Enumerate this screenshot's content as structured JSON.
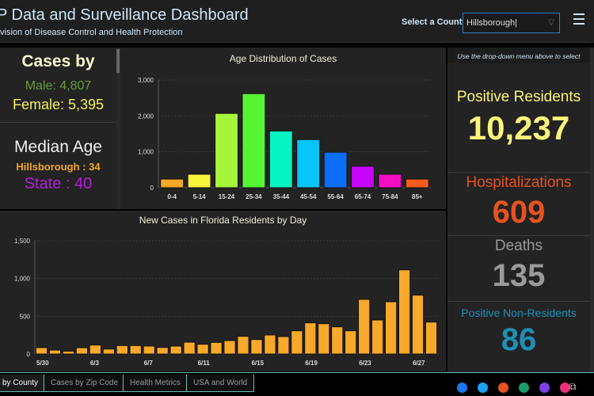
{
  "header": {
    "title": "P Data and Surveillance Dashboard",
    "subtitle": "vision of Disease Control and Health Protection",
    "county_label": "Select a County",
    "county_value": "Hillsborough"
  },
  "left": {
    "cases_by": "Cases by",
    "male": "Male: 4,807",
    "female": "Female: 5,395",
    "median_age": "Median Age",
    "county_median": "Hillsborough : 34",
    "state_median": "State : 40"
  },
  "right": {
    "hint": "Use the drop-down menu above to select",
    "positive_residents_label": "Positive Residents",
    "positive_residents": "10,237",
    "hospitalizations_label": "Hospitalizations",
    "hospitalizations": "609",
    "deaths_label": "Deaths",
    "deaths": "135",
    "non_residents_label": "Positive Non-Residents",
    "non_residents": "86"
  },
  "colors": {
    "male": "#6a9a3a",
    "female": "#f2f25a",
    "county_median": "#f5a623",
    "state_median": "#b01fd6",
    "positive": "#fbf679",
    "hosp": "#e8521f",
    "deaths": "#9a9a9a",
    "nonres": "#1f8fb5",
    "bar": "#f8a82a",
    "tab_border": "#6fb8b0"
  },
  "tabs": [
    "by County",
    "Cases by Zip Code",
    "Health Metrics",
    "USA and World"
  ],
  "social": [
    "facebook-icon",
    "twitter-icon",
    "embed-icon",
    "classroom-icon",
    "email-icon",
    "link-icon"
  ],
  "chart_data": [
    {
      "type": "bar",
      "title": "Age Distribution of Cases",
      "categories": [
        "0-4",
        "5-14",
        "15-24",
        "25-34",
        "35-44",
        "45-54",
        "55-64",
        "65-74",
        "75-84",
        "85+"
      ],
      "values": [
        240,
        375,
        2070,
        2620,
        1580,
        1340,
        990,
        600,
        375,
        240
      ],
      "colors": [
        "#f9a825",
        "#f7f23a",
        "#a6f53a",
        "#55f536",
        "#06f5c2",
        "#05c6f7",
        "#0c6df7",
        "#c505f5",
        "#f50dc6",
        "#fa5b1e"
      ],
      "yticks": [
        "0",
        "1,000",
        "2,000",
        "3,000"
      ],
      "ylim": [
        0,
        3000
      ],
      "grid": true
    },
    {
      "type": "bar",
      "title": "New Cases in Florida Residents by Day",
      "categories": [
        "5/30",
        "5/31",
        "6/1",
        "6/2",
        "6/3",
        "6/4",
        "6/5",
        "6/6",
        "6/7",
        "6/8",
        "6/9",
        "6/10",
        "6/11",
        "6/12",
        "6/13",
        "6/14",
        "6/15",
        "6/16",
        "6/17",
        "6/18",
        "6/19",
        "6/20",
        "6/21",
        "6/22",
        "6/23",
        "6/24",
        "6/25",
        "6/26",
        "6/27",
        "6/28"
      ],
      "xticks": [
        "5/30",
        "6/3",
        "6/7",
        "6/11",
        "6/15",
        "6/19",
        "6/23",
        "6/27"
      ],
      "values": [
        85,
        52,
        38,
        84,
        119,
        66,
        112,
        112,
        105,
        87,
        105,
        157,
        129,
        154,
        178,
        234,
        192,
        252,
        231,
        308,
        413,
        402,
        360,
        308,
        724,
        451,
        692,
        1115,
        780,
        423
      ],
      "yticks": [
        "0",
        "500",
        "1,000",
        "1,500"
      ],
      "ylim": [
        0,
        1500
      ],
      "grid": true
    }
  ]
}
